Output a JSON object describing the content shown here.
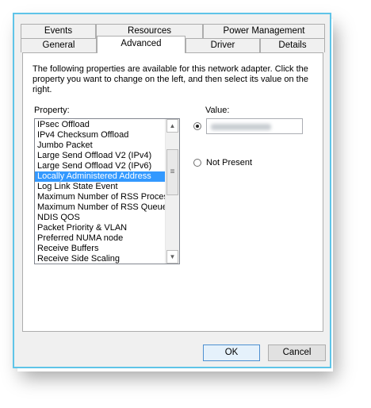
{
  "tabs": {
    "row_back": [
      {
        "label": "Events"
      },
      {
        "label": "Resources"
      },
      {
        "label": "Power Management"
      }
    ],
    "row_front": [
      {
        "label": "General"
      },
      {
        "label": "Advanced",
        "active": true
      },
      {
        "label": "Driver"
      },
      {
        "label": "Details"
      }
    ]
  },
  "advanced": {
    "description": "The following properties are available for this network adapter. Click the property you want to change on the left, and then select its value on the right.",
    "property_label": "Property:",
    "value_label": "Value:",
    "properties": [
      "IPsec Offload",
      "IPv4 Checksum Offload",
      "Jumbo Packet",
      "Large Send Offload V2 (IPv4)",
      "Large Send Offload V2 (IPv6)",
      "Locally Administered Address",
      "Log Link State Event",
      "Maximum Number of RSS Processors",
      "Maximum Number of RSS Queues",
      "NDIS QOS",
      "Packet Priority & VLAN",
      "Preferred NUMA node",
      "Receive Buffers",
      "Receive Side Scaling"
    ],
    "selected_property": "Locally Administered Address",
    "value_option_selected": "value",
    "not_present_label": "Not Present"
  },
  "buttons": {
    "ok": "OK",
    "cancel": "Cancel"
  },
  "colors": {
    "window_border": "#5fc4e8",
    "selection": "#3399ff",
    "dialog_bg": "#f0f0f0"
  },
  "icons": {
    "scroll_up": "chevron-up-icon",
    "scroll_down": "chevron-down-icon",
    "scroll_grip": "grip-icon"
  }
}
